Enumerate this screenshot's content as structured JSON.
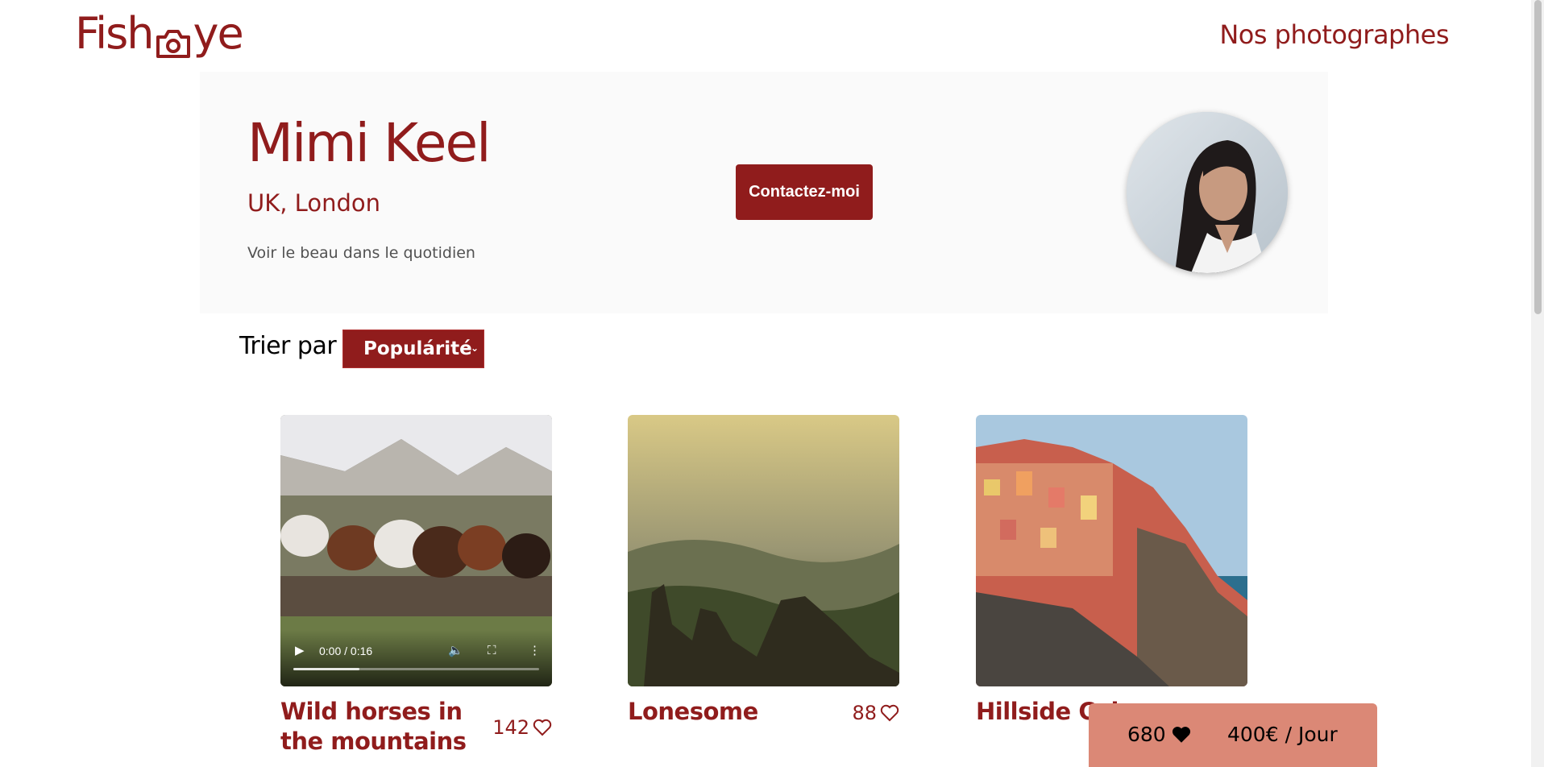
{
  "header": {
    "logo_left": "Fish",
    "logo_right": "ye",
    "nav_label": "Nos photographes"
  },
  "photographer": {
    "name": "Mimi Keel",
    "location": "UK, London",
    "tagline": "Voir le beau dans le quotidien",
    "contact_label": "Contactez-moi"
  },
  "sort": {
    "label": "Trier par",
    "selected": "Populárité"
  },
  "media": [
    {
      "title": "Wild horses in the mountains",
      "likes": "142",
      "type": "video",
      "time": "0:00 / 0:16"
    },
    {
      "title": "Lonesome",
      "likes": "88",
      "type": "image"
    },
    {
      "title": "Hillside Color",
      "likes": "",
      "type": "image"
    }
  ],
  "stats": {
    "total_likes": "680",
    "price": "400€ / Jour"
  },
  "colors": {
    "primary": "#901c1c",
    "banner_bg": "#fafafa",
    "stats_bg": "#db8876"
  }
}
